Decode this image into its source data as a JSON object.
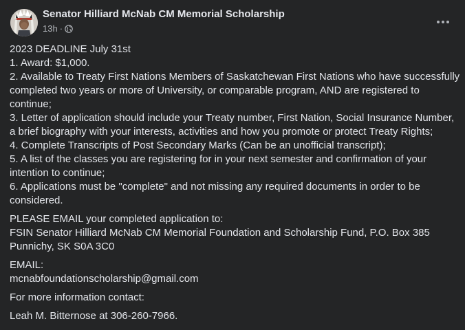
{
  "post": {
    "author": "Senator Hilliard McNab CM Memorial Scholarship",
    "time": "13h",
    "separator": "·",
    "privacy_icon": "globe-icon",
    "more_icon": "more-options-icon"
  },
  "content": {
    "deadline": "2023 DEADLINE July 31st",
    "item1": "1. Award: $1,000.",
    "item2_l1": "2. Available to Treaty First Nations Members of Saskatchewan First Nations who have successfully",
    "item2_l2": "completed two years or more of University, or comparable program, AND are registered to",
    "item2_l3": "continue;",
    "item3_l1": "3. Letter of application should include your Treaty number, First Nation, Social Insurance Number,",
    "item3_l2": "a brief biography with your interests, activities and how you promote or protect Treaty Rights;",
    "item4": "4. Complete Transcripts of Post Secondary Marks (Can be an unofficial transcript);",
    "item5_l1": "5. A list of the classes you are registering for in your next semester and confirmation of your",
    "item5_l2": "intention to continue;",
    "item6_l1": "6.  Applications must be \"complete\" and not missing any required documents in order to be",
    "item6_l2": "considered.",
    "email_intro": "PLEASE EMAIL your completed application to:",
    "address_l1": "FSIN Senator Hilliard McNab CM Memorial Foundation and Scholarship Fund, P.O. Box 385",
    "address_l2": "Punnichy, SK S0A 3C0",
    "email_label": "EMAIL:",
    "email": "mcnabfoundationscholarship@gmail.com",
    "contact_intro": "For more information contact:",
    "contact": "Leah M. Bitternose at 306-260-7966."
  },
  "colors": {
    "background": "#242526",
    "text": "#e4e6eb",
    "secondary_text": "#b0b3b8"
  }
}
